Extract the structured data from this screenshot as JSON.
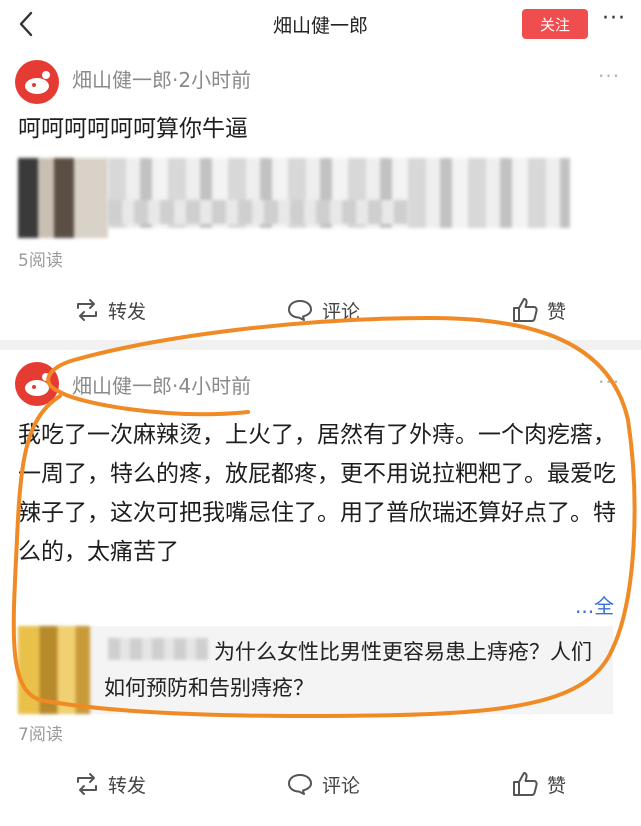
{
  "header": {
    "title": "畑山健一郎",
    "follow_label": "关注",
    "more_label": "···"
  },
  "posts": [
    {
      "author": "畑山健一郎",
      "time": "·2小时前",
      "more": "···",
      "text": "呵呵呵呵呵呵算你牛逼",
      "reads": "5阅读",
      "actions": {
        "repost": "转发",
        "comment": "评论",
        "like": "赞"
      }
    },
    {
      "author": "畑山健一郎",
      "time": "·4小时前",
      "more": "···",
      "text": "我吃了一次麻辣烫，上火了，居然有了外痔。一个肉疙瘩，一周了，特么的疼，放屁都疼，更不用说拉粑粑了。最爱吃辣子了，这次可把我嘴忌住了。用了普欣瑞还算好点了。特么的，太痛苦了",
      "expand": "...全",
      "shared_card": "为什么女性比男性更容易患上痔疮？人们如何预防和告别痔疮？",
      "reads": "7阅读",
      "actions": {
        "repost": "转发",
        "comment": "评论",
        "like": "赞"
      }
    }
  ],
  "colors": {
    "follow_bg": "#f04e4e",
    "avatar_bg": "#e63b32",
    "annotation": "#f08a24"
  },
  "icons": [
    "back-arrow-icon",
    "more-icon",
    "weibo-avatar-icon",
    "repost-icon",
    "comment-icon",
    "like-icon"
  ]
}
